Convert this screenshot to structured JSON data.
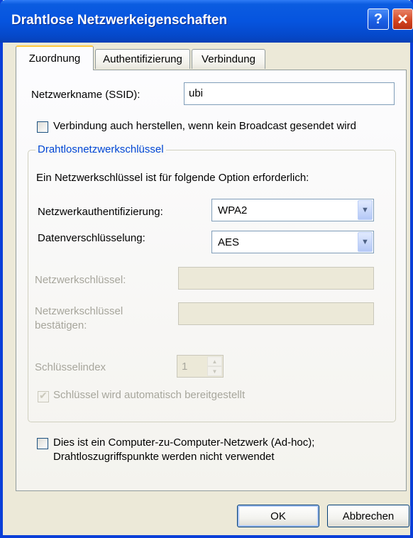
{
  "window": {
    "title": "Drahtlose Netzwerkeigenschaften",
    "help_glyph": "?",
    "close_glyph": "✕"
  },
  "tabs": [
    {
      "label": "Zuordnung",
      "active": true
    },
    {
      "label": "Authentifizierung",
      "active": false
    },
    {
      "label": "Verbindung",
      "active": false
    }
  ],
  "ssid": {
    "label": "Netzwerkname (SSID):",
    "value": "ubi"
  },
  "broadcast_checkbox": {
    "label": "Verbindung auch herstellen, wenn kein Broadcast gesendet wird",
    "checked": false
  },
  "key_group": {
    "title": "Drahtlosnetzwerkschlüssel",
    "intro": "Ein Netzwerkschlüssel ist für folgende Option erforderlich:",
    "auth_label": "Netzwerkauthentifizierung:",
    "auth_value": "WPA2",
    "enc_label": "Datenverschlüsselung:",
    "enc_value": "AES",
    "key_label": "Netzwerkschlüssel:",
    "key_value": "",
    "confirm_label_1": "Netzwerkschlüssel",
    "confirm_label_2": "bestätigen:",
    "confirm_value": "",
    "index_label": "Schlüsselindex",
    "index_value": "1",
    "auto_key_label": "Schlüssel wird automatisch bereitgestellt",
    "auto_key_checked": true
  },
  "adhoc_checkbox": {
    "line1": "Dies ist ein Computer-zu-Computer-Netzwerk (Ad-hoc);",
    "line2": "Drahtloszugriffspunkte werden nicht verwendet",
    "checked": false
  },
  "buttons": {
    "ok": "OK",
    "cancel": "Abbrechen"
  },
  "icons": {
    "dropdown": "chevron-down-icon",
    "check": "checkmark-icon"
  }
}
